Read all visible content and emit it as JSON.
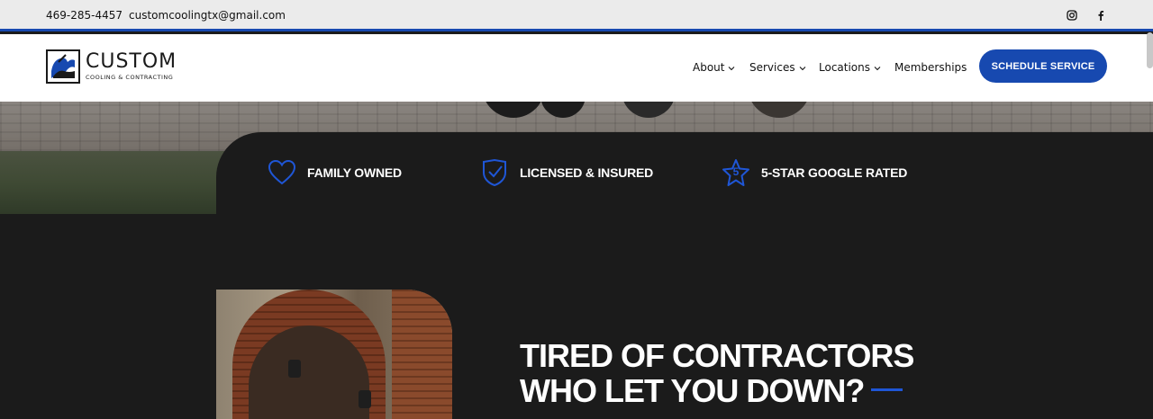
{
  "topbar": {
    "phone": "469-285-4457",
    "email": "customcoolingtx@gmail.com",
    "social": [
      "instagram-icon",
      "facebook-icon"
    ]
  },
  "header": {
    "logo_title": "CUSTOM",
    "logo_subtitle": "COOLING & CONTRACTING",
    "nav": [
      {
        "label": "About",
        "has_dropdown": true
      },
      {
        "label": "Services",
        "has_dropdown": true
      },
      {
        "label": "Locations",
        "has_dropdown": true
      },
      {
        "label": "Memberships",
        "has_dropdown": false
      }
    ],
    "cta_label": "SCHEDULE SERVICE"
  },
  "features": [
    {
      "icon": "heart-icon",
      "label": "FAMILY OWNED"
    },
    {
      "icon": "shield-check-icon",
      "label": "LICENSED & INSURED"
    },
    {
      "icon": "star-icon",
      "icon_text": "5",
      "label": "5-STAR GOOGLE RATED"
    }
  ],
  "section": {
    "headline_line1": "TIRED OF CONTRACTORS",
    "headline_line2": "WHO LET YOU DOWN?"
  },
  "colors": {
    "accent": "#1749b0",
    "dark_bg": "#1b1b1b",
    "topbar_bg": "#ebebeb"
  }
}
